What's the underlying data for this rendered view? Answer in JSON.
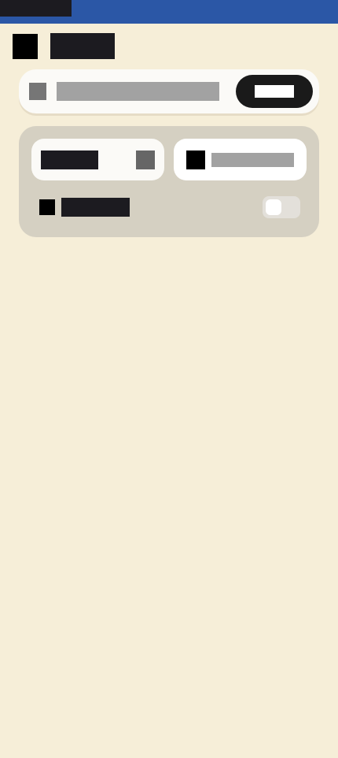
{
  "status_bar": {
    "left_text": ""
  },
  "header": {
    "icon": "menu-icon",
    "title": ""
  },
  "search": {
    "icon": "search-icon",
    "placeholder": "",
    "button_label": ""
  },
  "panel": {
    "chip_a": {
      "label": "",
      "icon": "dropdown-icon"
    },
    "chip_b": {
      "icon": "filter-icon",
      "label": ""
    },
    "toggle_row": {
      "icon": "option-icon",
      "label": "",
      "toggle_on": false
    }
  },
  "colors": {
    "background": "#f6eed8",
    "status_bar": "#2b57a6",
    "panel": "#d5d0c2",
    "button": "#1a1a1a",
    "text_dark": "#1c1b20",
    "text_muted": "#a2a2a2"
  }
}
